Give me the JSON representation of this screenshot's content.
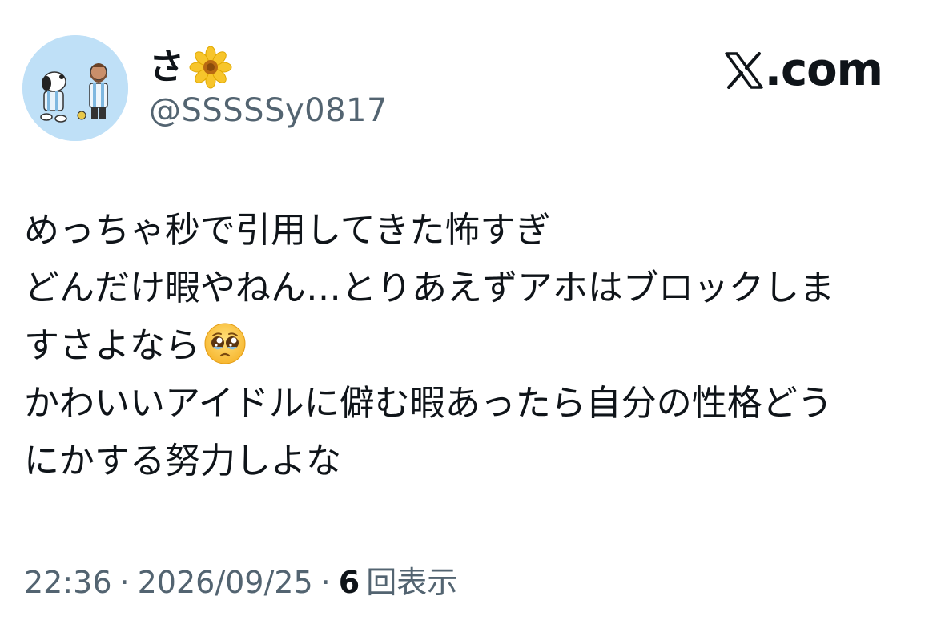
{
  "author": {
    "display_name": "さ",
    "display_name_emoji": "sunflower-icon",
    "username": "@SSSSSy0817",
    "avatar": "avatar-snoopy-and-bearded-figure",
    "avatar_bg": "#bfe0f7"
  },
  "brand": {
    "logo": "x-logo-icon",
    "text": ".com"
  },
  "tweet": {
    "lines": [
      "めっちゃ秒で引用してきた怖すぎ",
      "どんだけ暇やねん…とりあえずアホはブロックしま",
      "すさよなら",
      "かわいいアイドルに僻む暇あったら自分の性格どう",
      "にかする努力しよな"
    ],
    "line3_emoji": "pleading-face-icon"
  },
  "meta": {
    "time": "22:36",
    "separator": "·",
    "date": "2026/09/25",
    "views_count": "6",
    "views_label": "回表示"
  },
  "colors": {
    "text_primary": "#0f1419",
    "text_secondary": "#536471",
    "background": "#ffffff"
  }
}
